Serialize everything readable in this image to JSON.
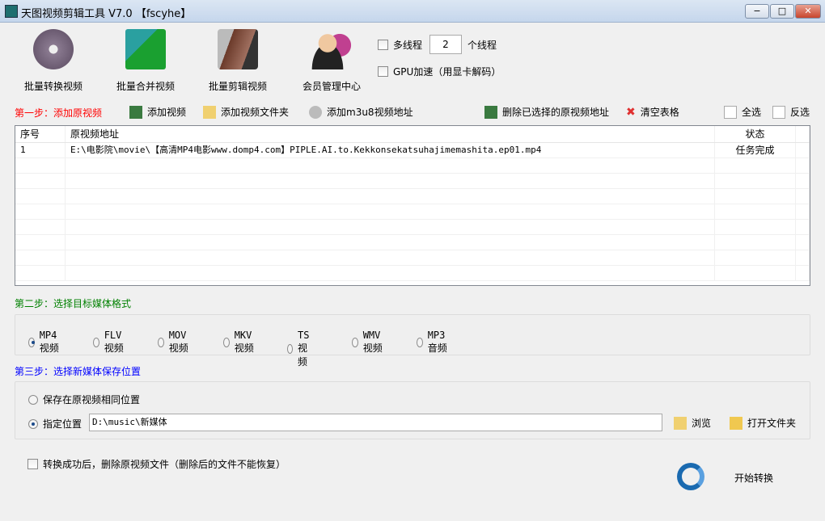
{
  "window": {
    "title": "天图视频剪辑工具 V7.0 【fscyhe】",
    "min": "−",
    "max": "□",
    "close": "✕"
  },
  "tools": [
    {
      "label": "批量转换视频"
    },
    {
      "label": "批量合并视频"
    },
    {
      "label": "批量剪辑视频"
    },
    {
      "label": "会员管理中心"
    }
  ],
  "options": {
    "multithread_label": "多线程",
    "thread_count": "2",
    "thread_suffix": "个线程",
    "gpu_label": "GPU加速（用显卡解码）"
  },
  "step1": {
    "label": "第一步：添加原视频",
    "add_video": "添加视频",
    "add_folder": "添加视频文件夹",
    "add_m3u8": "添加m3u8视频地址",
    "delete_selected": "删除已选择的原视频地址",
    "clear": "清空表格",
    "select_all": "全选",
    "invert": "反选"
  },
  "table": {
    "headers": [
      "序号",
      "原视频地址",
      "状态"
    ],
    "rows": [
      {
        "index": "1",
        "path": "E:\\电影院\\movie\\【高清MP4电影www.domp4.com】PIPLE.AI.to.Kekkonsekatsuhajimemashita.ep01.mp4",
        "status": "任务完成"
      }
    ]
  },
  "step2": {
    "label": "第二步：选择目标媒体格式",
    "formats": [
      "MP4视频",
      "FLV视频",
      "MOV视频",
      "MKV视频",
      "TS视频",
      "WMV视频",
      "MP3音频"
    ],
    "selected": "MP4视频"
  },
  "step3": {
    "label": "第三步：选择新媒体保存位置",
    "same_location": "保存在原视频相同位置",
    "specify": "指定位置",
    "path": "D:\\music\\新媒体",
    "browse": "浏览",
    "open_folder": "打开文件夹"
  },
  "bottom": {
    "delete_after": "转换成功后，删除原视频文件（删除后的文件不能恢复）",
    "start": "开始转换"
  },
  "colors": {
    "step1": "#ff0000",
    "step2": "#008000",
    "step3": "#0000ff"
  }
}
